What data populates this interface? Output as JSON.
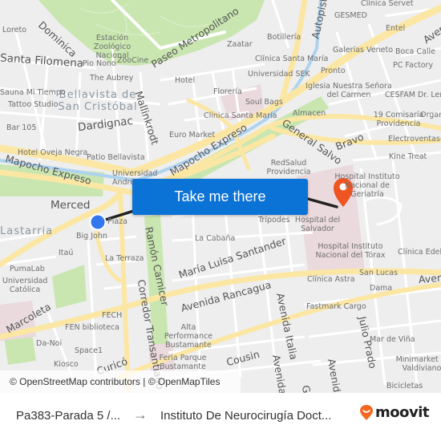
{
  "map": {
    "action_button": "Take me there",
    "attribution": "© OpenStreetMap contributors | © OpenMapTiles",
    "origin_marker": "origin-stop",
    "destination_marker": "destination-pin",
    "colors": {
      "route": "#222222",
      "origin": "#3377ee",
      "destination": "#ee5522",
      "button": "#0c73d6",
      "major_road": "#fbe7a3",
      "park": "#c9e6b0",
      "hospital": "#ead9dd",
      "background": "#eeeeee"
    },
    "street_labels": [
      "Dominica",
      "Santa Filomena",
      "Paseo Metropolitano",
      "Dardignac",
      "Mallinkrodt",
      "Mapocho Expreso",
      "Mapocho Expreso",
      "Merced",
      "General Salvo",
      "Bravo",
      "Ramón Carnicer",
      "María Luisa Santander",
      "Avenida Rancagua",
      "Corredor Transantiago",
      "Marcoleta",
      "Curicó",
      "Cousin",
      "Avenida Italia",
      "Avenida",
      "Julio Prado",
      "Autopista",
      "Avenida",
      "Avenida",
      "Avenida",
      "Gi"
    ],
    "district_labels": [
      "Bellavista de San Cristóbal",
      "Lastarria"
    ],
    "poi_labels": [
      "Loreto",
      "Estación Zoológico Nacional",
      "ZooCine",
      "Pio Nono",
      "The Aubrey",
      "Hotel",
      "Sauna Mi Tiempo",
      "Tattoo Studio",
      "Bar 105",
      "Florería",
      "Clínica Santa María",
      "Euro Market",
      "Hotel Oveja Negra",
      "Patio Bellavista",
      "Universidad Andrés",
      "Big John",
      "Plaza",
      "Itaú",
      "La Terraza",
      "PumaLab",
      "Universidad Católica",
      "FECH",
      "FEN biblioteca",
      "Da-Noi",
      "Space1",
      "Kiosco",
      "Alta Performance Bustamante",
      "Feria Parque Bustamante",
      "La Cabaña",
      "Trípodes",
      "Hospital del Salvador",
      "RedSalud Providencia",
      "Hospital Instituto Nacional de Geriatría",
      "Hospital Instituto Nacional del Tórax",
      "Clínica Edelweiss",
      "Clínica Astra",
      "San Lucas",
      "Dama",
      "Fastmark Cargo",
      "Mar de Viña",
      "Minimarket El Valdiviano",
      "Bicicletas",
      "Clínica Servet",
      "GESMED",
      "Entel",
      "Botillería",
      "Zaatar",
      "Galerías Veneto",
      "Boca Calle",
      "PC Factory",
      "Clínica Santa María",
      "Universidad SEK",
      "Pronto",
      "Iglesia Nuestra Señora del Carmen",
      "CESFAM Dr. Leng",
      "Soul Bags",
      "Almacen",
      "19 Comisaría Providencia",
      "Organ",
      "Electroventas-cl",
      "Kine Treat"
    ]
  },
  "footer": {
    "origin": "Pa383-Parada 5 /...",
    "arrow": "→",
    "destination": "Instituto De Neurocirugía Doct...",
    "brand": "moovit",
    "brand_color": "#f26722"
  }
}
